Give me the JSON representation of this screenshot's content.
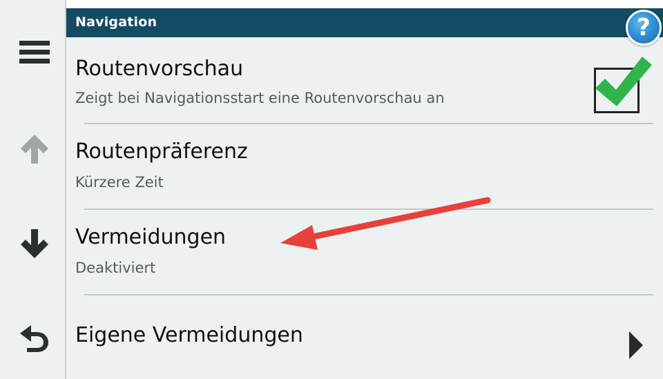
{
  "header": {
    "title": "Navigation"
  },
  "help": {
    "label": "?"
  },
  "sidebar": {
    "items": [
      {
        "icon": "menu-icon"
      },
      {
        "icon": "arrow-up-icon"
      },
      {
        "icon": "arrow-down-icon"
      },
      {
        "icon": "back-icon"
      }
    ]
  },
  "settings": [
    {
      "title": "Routenvorschau",
      "subtitle": "Zeigt bei Navigationsstart eine Routenvorschau an",
      "checked": true
    },
    {
      "title": "Routenpräferenz",
      "subtitle": "Kürzere Zeit"
    },
    {
      "title": "Vermeidungen",
      "subtitle": "Deaktiviert"
    },
    {
      "title": "Eigene Vermeidungen"
    }
  ],
  "colors": {
    "header_bg": "#144a64",
    "panel_bg": "#eef1f1",
    "check_green": "#2fb54a",
    "annotation_red": "#e8403a",
    "help_blue": "#2a8ad0"
  }
}
